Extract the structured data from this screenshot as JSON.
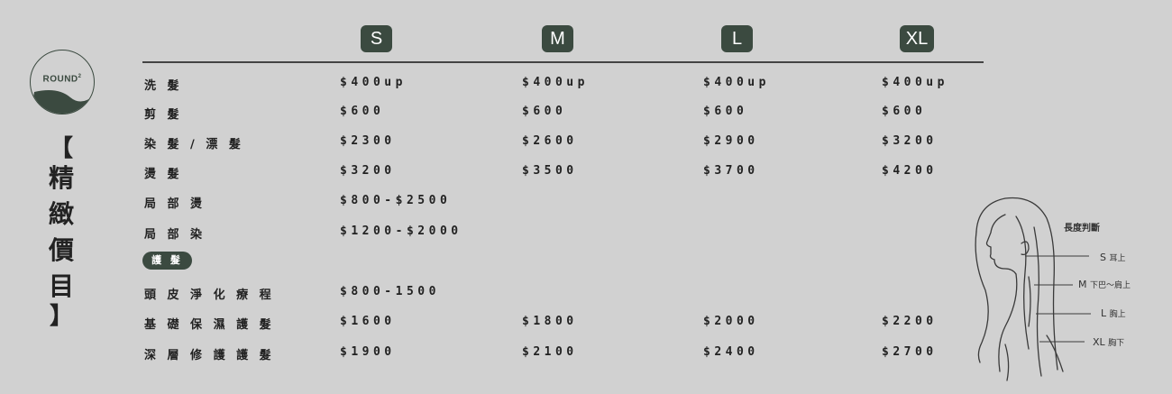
{
  "brand": {
    "name": "ROUND",
    "superscript": "2"
  },
  "title_chars": [
    "【",
    "精",
    "緻",
    "價",
    "目",
    "】"
  ],
  "sizes": [
    "S",
    "M",
    "L",
    "XL"
  ],
  "rows": [
    {
      "label": "洗 髮",
      "prices": [
        "$400up",
        "$400up",
        "$400up",
        "$400up"
      ]
    },
    {
      "label": "剪 髮",
      "prices": [
        "$600",
        "$600",
        "$600",
        "$600"
      ]
    },
    {
      "label": "染 髮 / 漂 髮",
      "prices": [
        "$2300",
        "$2600",
        "$2900",
        "$3200"
      ]
    },
    {
      "label": "燙 髮",
      "prices": [
        "$3200",
        "$3500",
        "$3700",
        "$4200"
      ]
    },
    {
      "label": "局 部 燙",
      "prices": [
        "$800-$2500",
        "",
        "",
        ""
      ]
    },
    {
      "label": "局 部 染",
      "prices": [
        "$1200-$2000",
        "",
        "",
        ""
      ]
    },
    {
      "label": "頭 皮 淨 化 療 程",
      "prices": [
        "$800-1500",
        "",
        "",
        ""
      ]
    },
    {
      "label": "基 礎 保 濕 護 髮",
      "prices": [
        "$1600",
        "$1800",
        "$2000",
        "$2200"
      ]
    },
    {
      "label": "深 層 修 護 護 髮",
      "prices": [
        "$1900",
        "$2100",
        "$2400",
        "$2700"
      ]
    }
  ],
  "section_pill": "護 髮",
  "length_guide": {
    "title": "長度判斷",
    "markers": [
      {
        "size": "S",
        "desc": "耳上"
      },
      {
        "size": "M",
        "desc": "下巴～肩上"
      },
      {
        "size": "L",
        "desc": "胸上"
      },
      {
        "size": "XL",
        "desc": "胸下"
      }
    ]
  },
  "colors": {
    "accent": "#3b4a40",
    "background": "#d1d1d1",
    "text": "#2b2b2b"
  }
}
